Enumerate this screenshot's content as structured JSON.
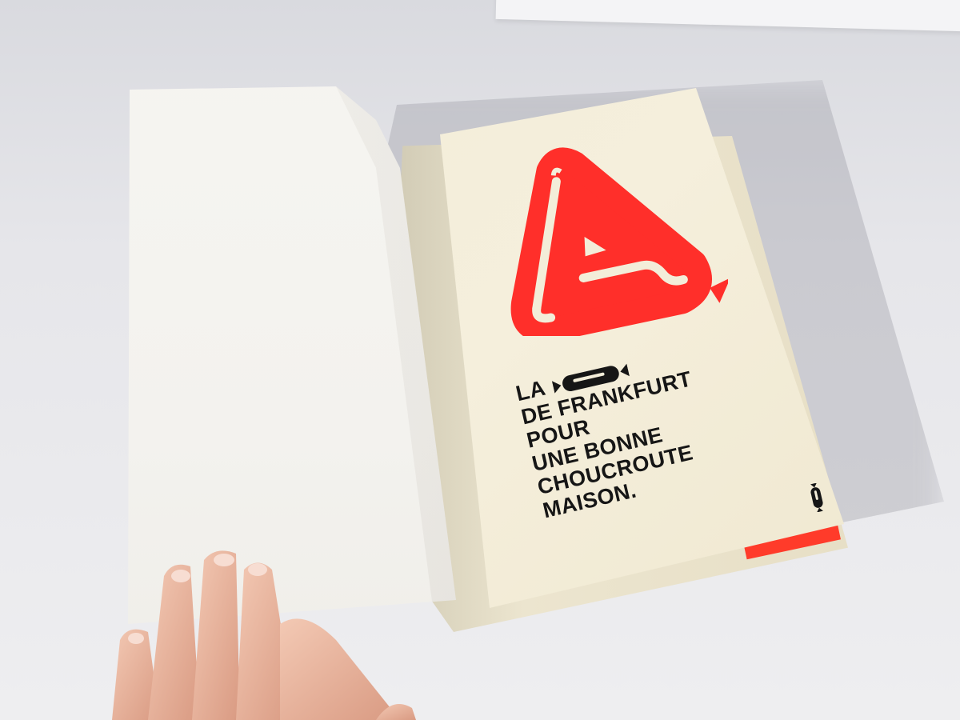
{
  "page": {
    "big_letter": "A.",
    "headline_lines": [
      "LA",
      "DE FRANKFURT",
      "POUR",
      "UNE BONNE",
      "CHOUCROUTE",
      "MAISON."
    ]
  },
  "colors": {
    "accent": "#ff2f2a",
    "paper": "#f3edd9",
    "ink": "#161616"
  },
  "icons": [
    "sausage-icon",
    "sausage-page-number-icon"
  ]
}
